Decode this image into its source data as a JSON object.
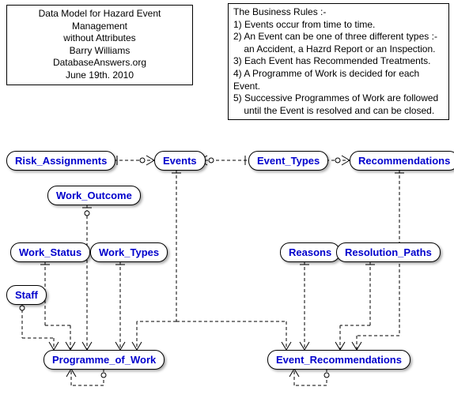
{
  "title": {
    "line1": "Data Model for Hazard Event Management",
    "line2": "without Attributes",
    "line3": "Barry Williams",
    "line4": "DatabaseAnswers.org",
    "line5": "June 19th. 2010"
  },
  "rules": {
    "heading": "The Business Rules :-",
    "r1": "1) Events occur from time to time.",
    "r2": "2) An Event can be one of three different types :-",
    "r2b": "    an Accident, a Hazrd Report or an Inspection.",
    "r3": "3) Each Event has Recommended Treatments.",
    "r4": "4) A Programme of Work is decided for each Event.",
    "r5": "5) Successive Programmes of Work are followed",
    "r5b": "    until the Event is resolved and can be closed."
  },
  "entities": {
    "risk_assignments": "Risk_Assignments",
    "events": "Events",
    "event_types": "Event_Types",
    "recommendations": "Recommendations",
    "work_outcome": "Work_Outcome",
    "work_status": "Work_Status",
    "work_types": "Work_Types",
    "reasons": "Reasons",
    "resolution_paths": "Resolution_Paths",
    "staff": "Staff",
    "programme_of_work": "Programme_of_Work",
    "event_recommendations": "Event_Recommendations"
  }
}
